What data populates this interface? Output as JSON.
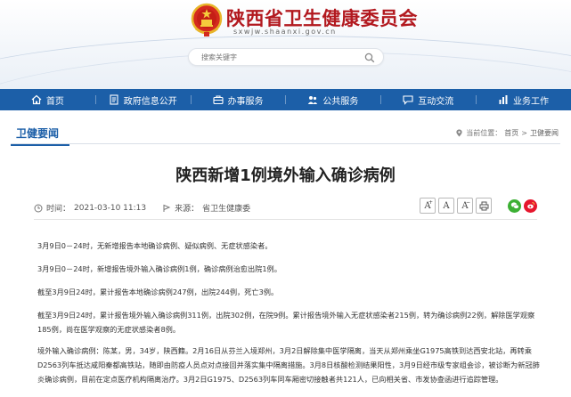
{
  "header": {
    "site_title": "陕西省卫生健康委员会",
    "site_url": "sxwjw.shaanxi.gov.cn",
    "search_placeholder": "搜索关键字",
    "colors": {
      "title_red": "#b2191f",
      "nav_blue": "#1c5fa8"
    }
  },
  "nav": {
    "items": [
      {
        "label": "首页",
        "icon": "home-icon"
      },
      {
        "label": "政府信息公开",
        "icon": "document-icon"
      },
      {
        "label": "办事服务",
        "icon": "briefcase-icon"
      },
      {
        "label": "公共服务",
        "icon": "people-icon"
      },
      {
        "label": "互动交流",
        "icon": "chat-icon"
      },
      {
        "label": "业务工作",
        "icon": "bar-chart-icon"
      }
    ]
  },
  "section": {
    "title": "卫健要闻",
    "breadcrumb": {
      "prefix": "当前位置：",
      "home": "首页",
      "sep": ">",
      "current": "卫健要闻"
    }
  },
  "article": {
    "title": "陕西新增1例境外输入确诊病例",
    "time_label": "时间：",
    "time": "2021-03-10 11:13",
    "source_label": "来源：",
    "source": "省卫生健康委",
    "tools": {
      "font_large": "A",
      "font_mid": "A",
      "font_small": "A"
    },
    "paragraphs": [
      "3月9日0－24时，无新增报告本地确诊病例、疑似病例、无症状感染者。",
      "3月9日0－24时，新增报告境外输入确诊病例1例，确诊病例治愈出院1例。",
      "截至3月9日24时，累计报告本地确诊病例247例，出院244例，死亡3例。",
      "截至3月9日24时，累计报告境外输入确诊病例311例，出院302例，在院9例。累计报告境外输入无症状感染者215例，转为确诊病例22例，解除医学观察185例，尚在医学观察的无症状感染者8例。",
      "境外输入确诊病例：陈某，男，34岁，陕西籍。2月16日从芬兰入境郑州，3月2日解除集中医学隔离，当天从郑州乘坐G1975高铁到达西安北站，再转乘D2563列车抵达咸阳秦都高铁站，随即由防疫人员点对点接回并落实集中隔离措施。3月8日核酸检测结果阳性，3月9日经市级专家组会诊，被诊断为新冠肺炎确诊病例，目前在定点医疗机构隔离治疗。3月2日G1975、D2563列车同车厢密切接触者共121人，已向相关省、市发协查函进行追踪管理。"
    ]
  }
}
